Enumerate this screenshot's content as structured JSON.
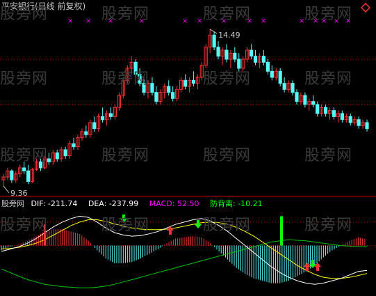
{
  "chart_data": [
    {
      "type": "candlestick",
      "title": "平安银行(日线 前复权)",
      "annotations": [
        {
          "label": "14.49"
        },
        {
          "label": "9.36"
        }
      ],
      "ohlc": [
        [
          9.5,
          9.7,
          9.3,
          9.6
        ],
        [
          9.6,
          9.9,
          9.5,
          9.8
        ],
        [
          9.8,
          9.85,
          9.4,
          9.5
        ],
        [
          9.5,
          9.8,
          9.4,
          9.7
        ],
        [
          9.7,
          10.0,
          9.6,
          9.9
        ],
        [
          9.9,
          10.1,
          9.7,
          9.8
        ],
        [
          9.8,
          10.0,
          9.36,
          9.45
        ],
        [
          9.45,
          9.9,
          9.4,
          9.85
        ],
        [
          9.85,
          10.2,
          9.8,
          10.1
        ],
        [
          10.1,
          10.2,
          9.8,
          9.9
        ],
        [
          9.9,
          10.3,
          9.85,
          10.2
        ],
        [
          10.2,
          10.4,
          10.0,
          10.1
        ],
        [
          10.1,
          10.5,
          10.0,
          10.4
        ],
        [
          10.4,
          10.5,
          10.1,
          10.2
        ],
        [
          10.2,
          10.6,
          10.1,
          10.5
        ],
        [
          10.5,
          10.6,
          10.2,
          10.3
        ],
        [
          10.3,
          10.8,
          10.2,
          10.7
        ],
        [
          10.7,
          10.9,
          10.5,
          10.6
        ],
        [
          10.6,
          11.0,
          10.5,
          10.9
        ],
        [
          10.9,
          11.2,
          10.8,
          11.1
        ],
        [
          11.1,
          11.3,
          10.9,
          11.0
        ],
        [
          11.0,
          11.5,
          10.9,
          11.4
        ],
        [
          11.4,
          11.6,
          11.1,
          11.2
        ],
        [
          11.2,
          11.7,
          11.1,
          11.6
        ],
        [
          11.6,
          11.9,
          11.4,
          11.5
        ],
        [
          11.5,
          11.8,
          11.3,
          11.7
        ],
        [
          11.7,
          11.9,
          11.5,
          11.6
        ],
        [
          11.6,
          12.0,
          11.5,
          11.9
        ],
        [
          11.9,
          12.4,
          11.8,
          12.3
        ],
        [
          12.3,
          12.9,
          12.2,
          12.8
        ],
        [
          12.8,
          13.3,
          12.7,
          13.2
        ],
        [
          13.2,
          13.6,
          13.0,
          13.4
        ],
        [
          13.4,
          13.5,
          12.9,
          13.0
        ],
        [
          13.0,
          13.2,
          12.6,
          12.7
        ],
        [
          12.7,
          12.9,
          12.3,
          12.4
        ],
        [
          12.4,
          12.8,
          12.2,
          12.7
        ],
        [
          12.7,
          12.9,
          12.3,
          12.4
        ],
        [
          12.4,
          12.6,
          12.0,
          12.1
        ],
        [
          12.1,
          12.5,
          12.0,
          12.4
        ],
        [
          12.4,
          12.7,
          12.2,
          12.6
        ],
        [
          12.6,
          12.8,
          12.3,
          12.4
        ],
        [
          12.4,
          12.6,
          12.1,
          12.2
        ],
        [
          12.2,
          12.6,
          12.1,
          12.5
        ],
        [
          12.5,
          12.9,
          12.4,
          12.8
        ],
        [
          12.8,
          13.0,
          12.5,
          12.6
        ],
        [
          12.6,
          12.9,
          12.4,
          12.8
        ],
        [
          12.8,
          13.1,
          12.6,
          12.7
        ],
        [
          12.7,
          13.0,
          12.5,
          12.9
        ],
        [
          12.9,
          13.4,
          12.8,
          13.3
        ],
        [
          13.3,
          14.0,
          13.2,
          13.9
        ],
        [
          13.9,
          14.49,
          13.7,
          14.3
        ],
        [
          14.3,
          14.4,
          13.8,
          13.9
        ],
        [
          13.9,
          14.1,
          13.5,
          13.6
        ],
        [
          13.6,
          13.9,
          13.3,
          13.8
        ],
        [
          13.8,
          14.0,
          13.4,
          13.5
        ],
        [
          13.5,
          13.8,
          13.2,
          13.7
        ],
        [
          13.7,
          13.9,
          13.4,
          13.5
        ],
        [
          13.5,
          13.7,
          13.1,
          13.2
        ],
        [
          13.2,
          13.6,
          13.1,
          13.5
        ],
        [
          13.5,
          13.9,
          13.4,
          13.8
        ],
        [
          13.8,
          14.0,
          13.5,
          13.6
        ],
        [
          13.6,
          13.8,
          13.3,
          13.4
        ],
        [
          13.4,
          13.7,
          13.2,
          13.6
        ],
        [
          13.6,
          13.8,
          13.3,
          13.4
        ],
        [
          13.4,
          13.5,
          13.0,
          13.1
        ],
        [
          13.1,
          13.3,
          12.8,
          12.9
        ],
        [
          12.9,
          13.2,
          12.8,
          13.1
        ],
        [
          13.1,
          13.2,
          12.6,
          12.7
        ],
        [
          12.7,
          12.9,
          12.4,
          12.5
        ],
        [
          12.5,
          12.8,
          12.4,
          12.7
        ],
        [
          12.7,
          12.8,
          12.3,
          12.4
        ],
        [
          12.4,
          12.5,
          12.0,
          12.1
        ],
        [
          12.1,
          12.4,
          12.0,
          12.3
        ],
        [
          12.3,
          12.4,
          11.9,
          12.0
        ],
        [
          12.0,
          12.2,
          11.8,
          12.1
        ],
        [
          12.1,
          12.3,
          11.9,
          12.0
        ],
        [
          12.0,
          12.1,
          11.6,
          11.7
        ],
        [
          11.7,
          12.0,
          11.6,
          11.9
        ],
        [
          11.9,
          12.0,
          11.6,
          11.7
        ],
        [
          11.7,
          11.9,
          11.5,
          11.8
        ],
        [
          11.8,
          11.9,
          11.5,
          11.6
        ],
        [
          11.6,
          11.8,
          11.4,
          11.7
        ],
        [
          11.7,
          11.8,
          11.4,
          11.5
        ],
        [
          11.5,
          11.7,
          11.4,
          11.6
        ],
        [
          11.6,
          11.7,
          11.3,
          11.4
        ],
        [
          11.4,
          11.6,
          11.3,
          11.5
        ],
        [
          11.5,
          11.6,
          11.2,
          11.3
        ],
        [
          11.3,
          11.5,
          11.2,
          11.4
        ],
        [
          11.4,
          11.5,
          11.1,
          11.2
        ]
      ],
      "ylim": [
        9.0,
        15.0
      ]
    },
    {
      "type": "macd",
      "title": "股旁网",
      "indicators": [
        {
          "name": "DIF",
          "value": "-211.74",
          "color": "#ffffff"
        },
        {
          "name": "DEA",
          "value": "-237.99",
          "color": "#ffffff"
        },
        {
          "name": "MACD",
          "value": "52.50",
          "color": "#ff00ff"
        },
        {
          "name": "防背离",
          "value": "-10.21",
          "color": "#00ff00"
        }
      ],
      "dif": [
        -50,
        -30,
        -10,
        20,
        60,
        110,
        160,
        200,
        230,
        250,
        240,
        200,
        150,
        110,
        90,
        80,
        85,
        100,
        120,
        150,
        180,
        200,
        220,
        230,
        210,
        170,
        120,
        60,
        0,
        -60,
        -120,
        -180,
        -230,
        -270,
        -300,
        -320,
        -330,
        -320,
        -300,
        -280,
        -250,
        -220,
        -211.74
      ],
      "dea": [
        -30,
        -25,
        -15,
        0,
        20,
        50,
        90,
        130,
        170,
        200,
        220,
        220,
        205,
        185,
        165,
        150,
        140,
        135,
        135,
        140,
        150,
        165,
        180,
        195,
        200,
        195,
        180,
        155,
        120,
        80,
        30,
        -20,
        -70,
        -120,
        -170,
        -210,
        -245,
        -270,
        -280,
        -280,
        -270,
        -255,
        -237.99
      ],
      "macd_hist": [
        -40,
        -10,
        10,
        40,
        80,
        120,
        140,
        140,
        120,
        100,
        40,
        -40,
        -110,
        -150,
        -150,
        -140,
        -110,
        -70,
        -30,
        20,
        60,
        70,
        80,
        70,
        20,
        -50,
        -120,
        -190,
        -240,
        -280,
        -300,
        -320,
        -320,
        -300,
        -260,
        -220,
        -170,
        -100,
        -40,
        0,
        40,
        70,
        52.5
      ],
      "defense": [
        -200,
        -230,
        -260,
        -290,
        -310,
        -330,
        -340,
        -350,
        -355,
        -360,
        -360,
        -355,
        -345,
        -330,
        -310,
        -290,
        -270,
        -250,
        -230,
        -210,
        -190,
        -170,
        -150,
        -130,
        -110,
        -90,
        -70,
        -50,
        -30,
        -10,
        10,
        30,
        40,
        50,
        45,
        40,
        30,
        20,
        10,
        0,
        -5,
        -8,
        -10.21
      ],
      "ylim": [
        -400,
        300
      ]
    }
  ],
  "watermarks": [
    "股旁网",
    "股旁网",
    "股旁网",
    "股旁网",
    "股旁网",
    "股旁网",
    "股旁网",
    "股旁网",
    "股旁网"
  ],
  "colors": {
    "up": "#ff3232",
    "down": "#54fcfc",
    "dif": "#ffffff",
    "dea": "#ffff00",
    "defense": "#00c800",
    "grid": "#c80000"
  },
  "icons": {
    "corner_button": "diamond-icon"
  }
}
